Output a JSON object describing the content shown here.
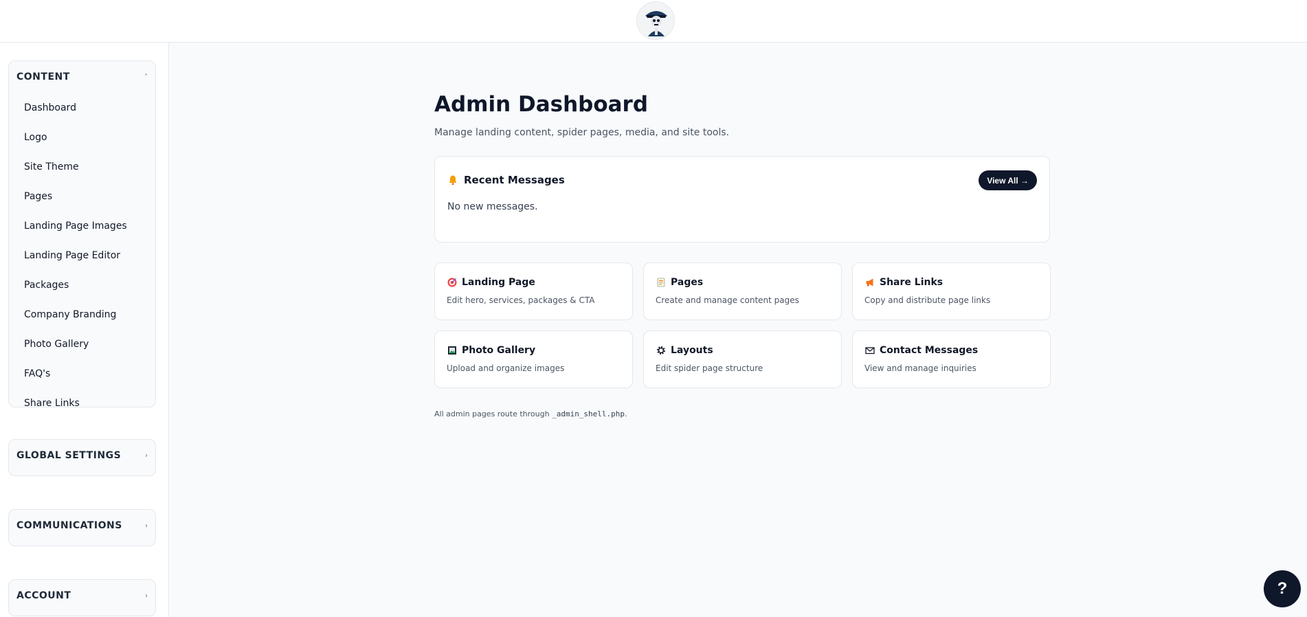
{
  "sidebar": {
    "groups": [
      {
        "title": "CONTENT",
        "chevron": "˄",
        "items": [
          "Dashboard",
          "Logo",
          "Site Theme",
          "Pages",
          "Landing Page Images",
          "Landing Page Editor",
          "Packages",
          "Company Branding",
          "Photo Gallery",
          "FAQ's",
          "Share Links"
        ]
      },
      {
        "title": "GLOBAL SETTINGS",
        "chevron": "›"
      },
      {
        "title": "COMMUNICATIONS",
        "chevron": "›"
      },
      {
        "title": "ACCOUNT",
        "chevron": "›"
      }
    ]
  },
  "main": {
    "title": "Admin Dashboard",
    "subtitle": "Manage landing content, spider pages, media, and site tools.",
    "messages": {
      "icon": "bell-icon",
      "title": "Recent Messages",
      "view_all": "View All →",
      "empty": "No new messages."
    },
    "tiles": [
      {
        "icon": "target-icon",
        "title": "Landing Page",
        "desc": "Edit hero, services, packages & CTA"
      },
      {
        "icon": "page-icon",
        "title": "Pages",
        "desc": "Create and manage content pages"
      },
      {
        "icon": "megaphone-icon",
        "title": "Share Links",
        "desc": "Copy and distribute page links"
      },
      {
        "icon": "image-frame-icon",
        "title": "Photo Gallery",
        "desc": "Upload and organize images"
      },
      {
        "icon": "gear-icon",
        "title": "Layouts",
        "desc": "Edit spider page structure"
      },
      {
        "icon": "envelope-icon",
        "title": "Contact Messages",
        "desc": "View and manage inquiries"
      }
    ],
    "footnote_prefix": "All admin pages route through ",
    "footnote_code": "_admin_shell.php",
    "footnote_suffix": "."
  },
  "help_label": "?",
  "colors": {
    "accent": "#0f172a",
    "bell": "#f59e0b",
    "border": "#e5e7eb"
  }
}
